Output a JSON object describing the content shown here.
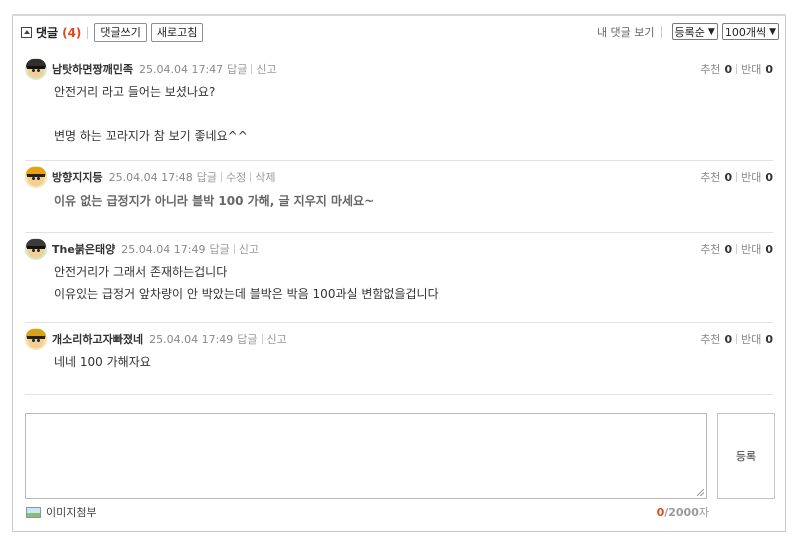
{
  "header": {
    "title": "댓글",
    "count": "(4)",
    "write_button": "댓글쓰기",
    "refresh_button": "새로고침",
    "my_comments_link": "내 댓글 보기",
    "sort_select": "등록순",
    "per_page_select": "100개씩"
  },
  "comments": [
    {
      "nickname": "남탓하면짱깨민족",
      "datetime": "25.04.04 17:47",
      "actions": [
        "답글",
        "신고"
      ],
      "lines": [
        "안전거리 라고 들어는 보셨나요?",
        "",
        "변명 하는 꼬라지가 참 보기 좋네요^^"
      ],
      "bold": false,
      "upvote_label": "추천",
      "upvotes": "0",
      "downvote_label": "반대",
      "downvotes": "0"
    },
    {
      "nickname": "방향지지등",
      "datetime": "25.04.04 17:48",
      "actions": [
        "답글",
        "수정",
        "삭제"
      ],
      "lines": [
        "이유 없는 급정지가 아니라 블박 100 가해, 글 지우지 마세요~"
      ],
      "bold": true,
      "upvote_label": "추천",
      "upvotes": "0",
      "downvote_label": "반대",
      "downvotes": "0"
    },
    {
      "nickname": "The붉은태양",
      "datetime": "25.04.04 17:49",
      "actions": [
        "답글",
        "신고"
      ],
      "lines": [
        "안전거리가 그래서 존재하는겁니다",
        "이유있는 급정거 앞차량이 안 박았는데 블박은 박음 100과실 변함없을겁니다"
      ],
      "bold": false,
      "upvote_label": "추천",
      "upvotes": "0",
      "downvote_label": "반대",
      "downvotes": "0"
    },
    {
      "nickname": "개소리하고자빠졌네",
      "datetime": "25.04.04 17:49",
      "actions": [
        "답글",
        "신고"
      ],
      "lines": [
        "네네 100 가해자요"
      ],
      "bold": false,
      "upvote_label": "추천",
      "upvotes": "0",
      "downvote_label": "반대",
      "downvotes": "0"
    }
  ],
  "write": {
    "textarea_value": "",
    "submit_button": "등록",
    "attach_label": "이미지첨부",
    "char_count": "0",
    "char_max": "/2000",
    "char_unit": "자"
  },
  "colors": {
    "accent": "#e0481c"
  }
}
